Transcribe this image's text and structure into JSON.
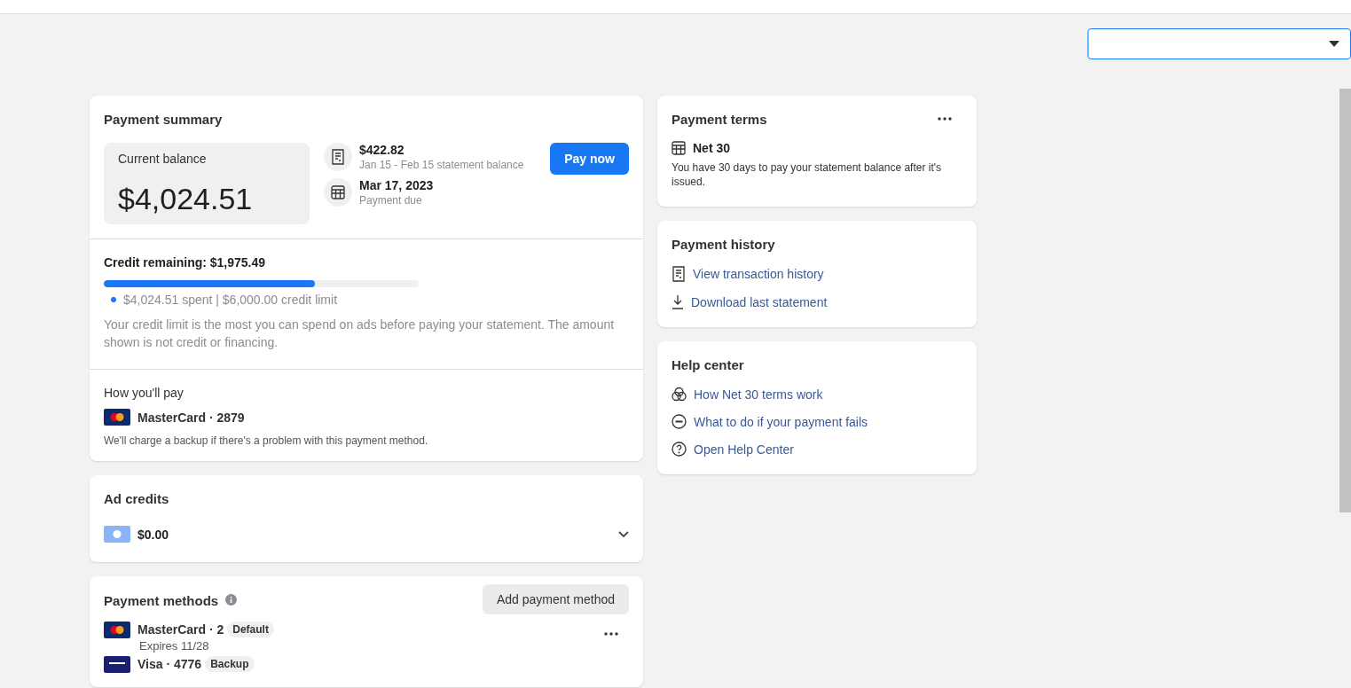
{
  "payment_summary": {
    "title": "Payment summary",
    "balance_label": "Current balance",
    "balance": "$4,024.51",
    "statement_amount": "$422.82",
    "statement_caption": "Jan 15 - Feb 15 statement balance",
    "due_date": "Mar 17, 2023",
    "due_caption": "Payment due",
    "pay_button": "Pay now",
    "credit": {
      "title": "Credit remaining: $1,975.49",
      "level": 0.67,
      "legend": "$4,024.51 spent | $6,000.00 credit limit",
      "note": "Your credit limit is the most you can spend on ads before paying your statement. The amount shown is not credit or financing."
    },
    "pay_title": "How you'll pay",
    "pay_method": "MasterCard · 2879",
    "pay_note": "We'll charge a backup if there's a problem with this payment method."
  },
  "ad_credits": {
    "title": "Ad credits",
    "amount": "$0.00",
    "expanded": false
  },
  "payment_methods": {
    "title": "Payment methods",
    "add_button": "Add payment method",
    "methods": [
      {
        "kind": "mastercard",
        "name": "MasterCard · 2",
        "badge": "Default",
        "expires": "Expires 11/28"
      },
      {
        "kind": "visa",
        "name": "Visa · 4776",
        "badge": "Backup"
      }
    ]
  },
  "payment_terms": {
    "title": "Payment terms",
    "plan": "Net 30",
    "description": "You have 30 days to pay your statement balance after it's issued."
  },
  "payment_history": {
    "title": "Payment history",
    "links": [
      {
        "kind": "receipt",
        "label": "View transaction history"
      },
      {
        "kind": "download",
        "label": "Download last statement"
      }
    ]
  },
  "help_center": {
    "title": "Help center",
    "links": [
      {
        "kind": "globe",
        "label": "How Net 30 terms work"
      },
      {
        "kind": "minus",
        "label": "What to do if your payment fails"
      },
      {
        "kind": "question",
        "label": "Open Help Center"
      }
    ]
  }
}
